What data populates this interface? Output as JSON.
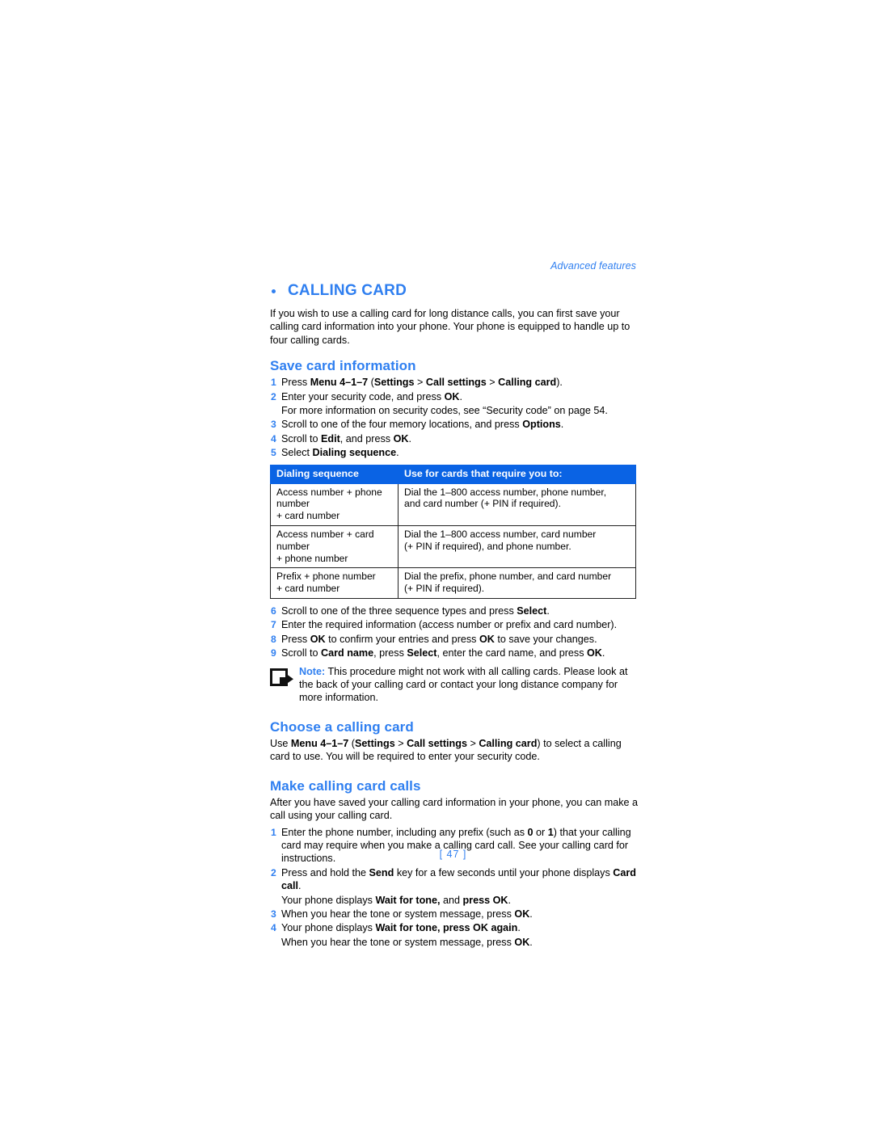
{
  "header": {
    "running_head": "Advanced features"
  },
  "section": {
    "title": "CALLING CARD",
    "intro": "If you wish to use a calling card for long distance calls, you can first save your calling card information into your phone. Your phone is equipped to handle up to four calling cards."
  },
  "save_card": {
    "heading": "Save card information",
    "steps": [
      {
        "num": "1",
        "html": "Press <b>Menu 4–1–7</b> (<b>Settings</b> &gt; <b>Call settings</b> &gt; <b>Calling card</b>)."
      },
      {
        "num": "2",
        "html": "Enter your security code, and press <b>OK</b>."
      },
      {
        "num": "",
        "html": "For more information on security codes, see “Security code” on page 54."
      },
      {
        "num": "3",
        "html": "Scroll to one of the four memory locations, and press <b>Options</b>."
      },
      {
        "num": "4",
        "html": "Scroll to <b>Edit</b>, and press <b>OK</b>."
      },
      {
        "num": "5",
        "html": "Select <b>Dialing sequence</b>."
      }
    ],
    "steps_after": [
      {
        "num": "6",
        "html": "Scroll to one of the three sequence types and press <b>Select</b>."
      },
      {
        "num": "7",
        "html": "Enter the required information (access number or prefix and card number)."
      },
      {
        "num": "8",
        "html": "Press <b>OK</b> to confirm your entries and press <b>OK</b> to save your changes."
      },
      {
        "num": "9",
        "html": "Scroll to <b>Card name</b>, press <b>Select</b>, enter the card name, and press <b>OK</b>."
      }
    ]
  },
  "table": {
    "columns": [
      "Dialing sequence",
      "Use for cards that require you to:"
    ],
    "rows": [
      [
        "Access number + phone number\n+ card number",
        "Dial the 1–800 access number, phone number,\nand card number (+ PIN if required)."
      ],
      [
        "Access number + card number\n+ phone number",
        "Dial the 1–800 access number, card number\n(+ PIN if required), and phone number."
      ],
      [
        "Prefix + phone number\n+ card number",
        "Dial the prefix, phone number, and card number\n(+ PIN if required)."
      ]
    ]
  },
  "note": {
    "icon": "note-arrow-icon",
    "label": "Note:",
    "text": "This procedure might not work with all calling cards. Please look at the back of your calling card or contact your long distance company for more information."
  },
  "choose_card": {
    "heading": "Choose a calling card",
    "body_html": "Use <b>Menu 4–1–7</b> (<b>Settings</b> &gt; <b>Call settings</b> &gt; <b>Calling card</b>) to select a calling card to use. You will be required to enter your security code."
  },
  "make_calls": {
    "heading": "Make calling card calls",
    "intro": "After you have saved your calling card information in your phone, you can make a call using your calling card.",
    "steps": [
      {
        "num": "1",
        "html": "Enter the phone number, including any prefix (such as <b>0</b> or <b>1</b>) that your calling card may require when you make a calling card call. See your calling card for instructions."
      },
      {
        "num": "2",
        "html": "Press and hold the <b>Send</b> key for a few seconds until your phone displays <b>Card call</b>."
      },
      {
        "num": "",
        "html": "Your phone displays <b>Wait for tone,</b> and <b>press OK</b>."
      },
      {
        "num": "3",
        "html": "When you hear the tone or system message, press <b>OK</b>."
      },
      {
        "num": "4",
        "html": "Your phone displays <b>Wait for tone, press OK again</b>."
      },
      {
        "num": "",
        "html": "When you hear the tone or system message, press <b>OK</b>."
      }
    ]
  },
  "footer": {
    "page_number": "[ 47 ]"
  },
  "colors": {
    "accent_blue": "#2f7ff0",
    "table_header_blue": "#0a63e4",
    "text_black": "#000000"
  }
}
